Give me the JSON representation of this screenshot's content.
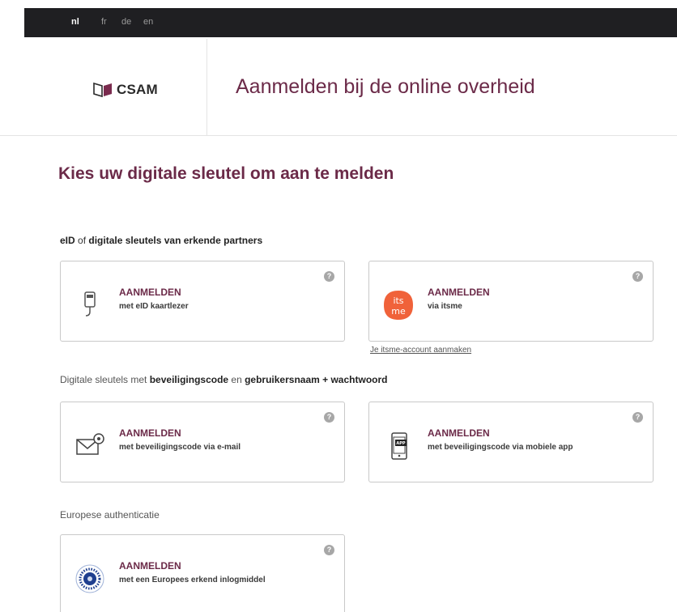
{
  "languages": [
    "nl",
    "fr",
    "de",
    "en"
  ],
  "active_language": "nl",
  "header": {
    "logo_text": "CSAM",
    "title": "Aanmelden bij de online overheid"
  },
  "main": {
    "heading": "Kies uw digitale sleutel om aan te melden",
    "sections": {
      "partners": {
        "part1": "eID",
        "part2": " of ",
        "part3": "digitale sleutels van erkende partners"
      },
      "codes": {
        "part1": "Digitale sleutels met ",
        "part2": "beveiligingscode",
        "part3": " en ",
        "part4": "gebruikersnaam + wachtwoord"
      },
      "europe": {
        "label": "Europese authenticatie"
      }
    },
    "cards": {
      "eid": {
        "title": "AANMELDEN",
        "subtitle": "met eID kaartlezer",
        "icon": "card-reader-icon"
      },
      "itsme": {
        "title": "AANMELDEN",
        "subtitle": "via itsme",
        "icon": "itsme-logo",
        "logo_text_top": "its",
        "logo_text_bottom": "me"
      },
      "email": {
        "title": "AANMELDEN",
        "subtitle": "met beveiligingscode via e-mail",
        "icon": "envelope-icon"
      },
      "app": {
        "title": "AANMELDEN",
        "subtitle": "met beveiligingscode via mobiele app",
        "icon": "mobile-app-icon",
        "badge": "APP"
      },
      "europe": {
        "title": "AANMELDEN",
        "subtitle": "met een Europees erkend inlogmiddel",
        "icon": "eu-stars-icon"
      }
    },
    "help_glyph": "?",
    "itsme_link": "Je itsme-account aanmaken"
  },
  "colors": {
    "accent": "#6b2a48",
    "topbar": "#1f1f22",
    "itsme": "#f0623a",
    "eu_blue": "#1f3f8f"
  }
}
